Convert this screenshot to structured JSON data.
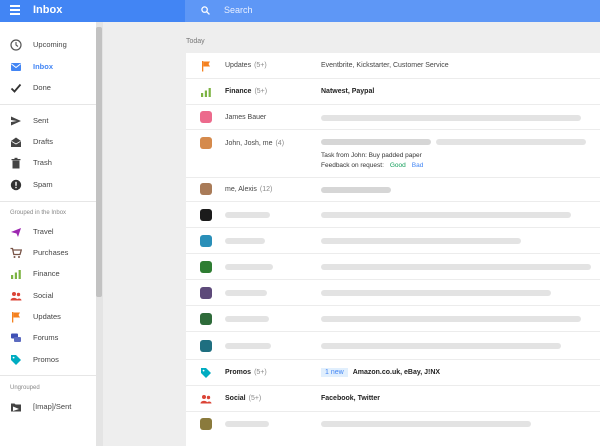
{
  "header": {
    "app_title": "Inbox",
    "search_placeholder": "Search",
    "color": "#4285f4"
  },
  "sidebar": {
    "items": [
      {
        "label": "Upcoming",
        "icon": "clock-icon"
      },
      {
        "label": "Inbox",
        "icon": "inbox-icon",
        "active": true
      },
      {
        "label": "Done",
        "icon": "checkmark-icon"
      },
      {
        "label": "Sent",
        "icon": "send-icon"
      },
      {
        "label": "Drafts",
        "icon": "drafts-icon"
      },
      {
        "label": "Trash",
        "icon": "trash-icon"
      },
      {
        "label": "Spam",
        "icon": "spam-icon"
      }
    ],
    "grouped_header": "Grouped in the Inbox",
    "groups": [
      {
        "label": "Travel",
        "icon": "plane-icon",
        "color": "#9c27b0"
      },
      {
        "label": "Purchases",
        "icon": "cart-icon",
        "color": "#795548"
      },
      {
        "label": "Finance",
        "icon": "finance-icon",
        "color": "#7cb342"
      },
      {
        "label": "Social",
        "icon": "people-icon",
        "color": "#db4437"
      },
      {
        "label": "Updates",
        "icon": "flag-icon",
        "color": "#f4811f"
      },
      {
        "label": "Forums",
        "icon": "forum-icon",
        "color": "#3f51b5"
      },
      {
        "label": "Promos",
        "icon": "tag-icon",
        "color": "#00acc1"
      }
    ],
    "ungrouped_header": "Ungrouped",
    "ungrouped": [
      {
        "label": "[Imap]/Sent",
        "icon": "folder-icon"
      }
    ]
  },
  "main": {
    "date_header": "Today",
    "rows": {
      "updates": {
        "sender": "Updates",
        "count": "(5+)",
        "summary": "Eventbrite, Kickstarter, Customer Service"
      },
      "finance": {
        "sender": "Finance",
        "count": "(5+)",
        "summary": "Natwest, Paypal"
      },
      "james": {
        "sender": "James Bauer"
      },
      "john": {
        "sender": "John, Josh, me",
        "count": "(4)",
        "task": "Task from John: Buy padded paper",
        "feedback_label": "Feedback on request:",
        "good": "Good",
        "bad": "Bad"
      },
      "alexis": {
        "sender": "me, Alexis",
        "count": "(12)"
      },
      "promos": {
        "sender": "Promos",
        "count": "(5+)",
        "badge": "1 new",
        "summary": "Amazon.co.uk, eBay, J!NX"
      },
      "social": {
        "sender": "Social",
        "count": "(5+)",
        "summary": "Facebook, Twitter"
      }
    }
  }
}
